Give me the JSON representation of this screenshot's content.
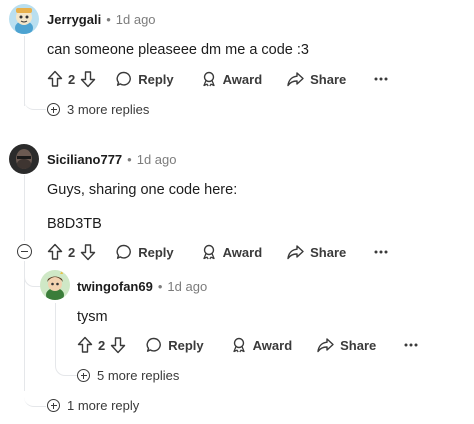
{
  "comments": [
    {
      "username": "Jerrygali",
      "time": "1d ago",
      "text_lines": [
        "can someone pleaseee dm me a code :3"
      ],
      "score": "2",
      "reply_label": "Reply",
      "award_label": "Award",
      "share_label": "Share",
      "more_replies": "3 more replies"
    },
    {
      "username": "Siciliano777",
      "time": "1d ago",
      "text_lines": [
        "Guys, sharing one code here:",
        "B8D3TB"
      ],
      "score": "2",
      "reply_label": "Reply",
      "award_label": "Award",
      "share_label": "Share",
      "more_replies": "1 more reply"
    },
    {
      "username": "twingofan69",
      "time": "1d ago",
      "text_lines": [
        "tysm"
      ],
      "score": "2",
      "reply_label": "Reply",
      "award_label": "Award",
      "share_label": "Share",
      "more_replies": "5 more replies"
    }
  ],
  "separator": "•",
  "icons": {
    "upvote": "upvote-arrow-icon",
    "downvote": "downvote-arrow-icon",
    "reply": "speech-bubble-icon",
    "award": "award-ribbon-icon",
    "share": "share-arrow-icon",
    "overflow": "ellipsis-icon",
    "expand": "plus-circle-icon",
    "collapse": "minus-circle-icon"
  },
  "colors": {
    "text": "#1c1c1c",
    "meta": "#7c7c7c",
    "thread_line": "#e5e7ea"
  }
}
